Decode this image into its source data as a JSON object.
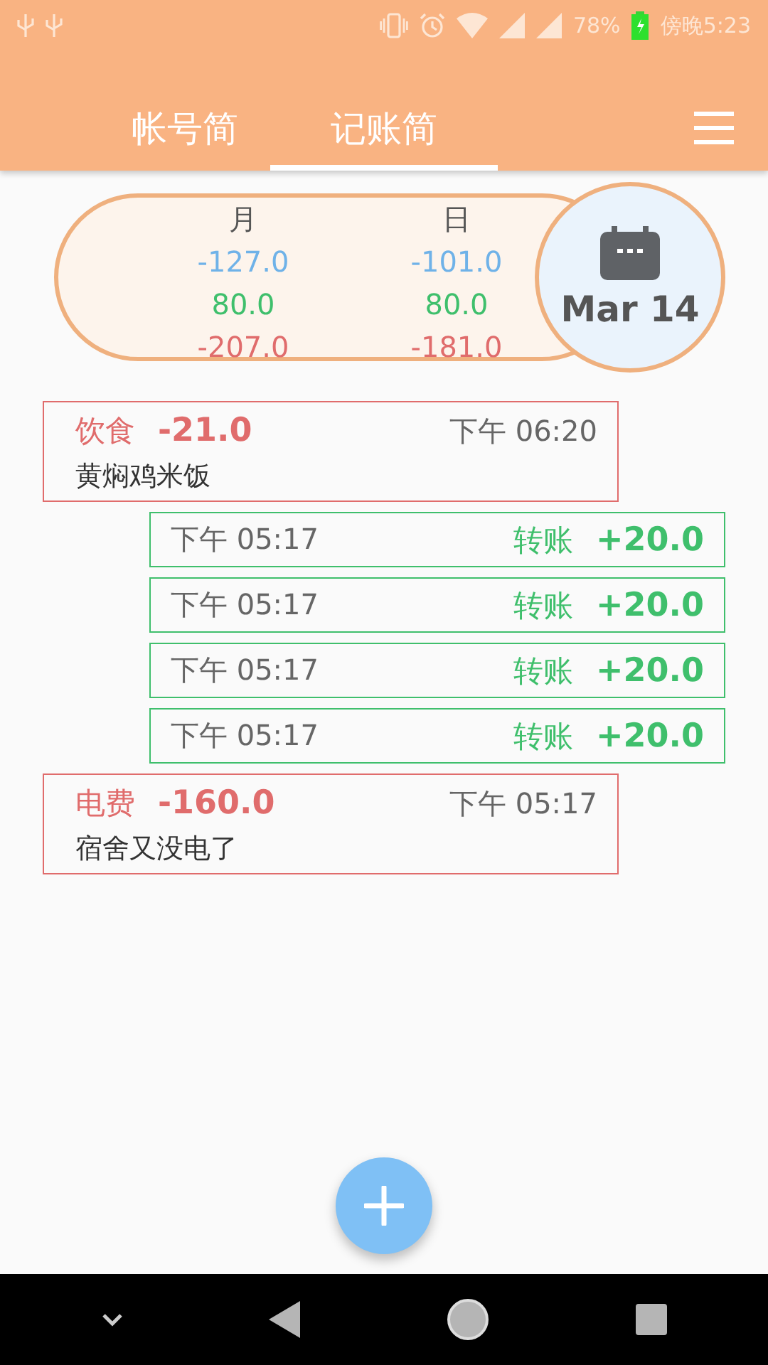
{
  "status_bar": {
    "battery": "78%",
    "time": "傍晚5:23"
  },
  "tabs": [
    {
      "label": "帐号简",
      "selected": false
    },
    {
      "label": "记账简",
      "selected": true
    }
  ],
  "summary": {
    "columns": [
      {
        "label": "月",
        "values": [
          {
            "kind": "balance",
            "text": "-127.0"
          },
          {
            "kind": "income",
            "text": "80.0"
          },
          {
            "kind": "expense",
            "text": "-207.0"
          }
        ]
      },
      {
        "label": "日",
        "values": [
          {
            "kind": "balance",
            "text": "-101.0"
          },
          {
            "kind": "income",
            "text": "80.0"
          },
          {
            "kind": "expense",
            "text": "-181.0"
          }
        ]
      }
    ],
    "date": "Mar 14"
  },
  "entries": [
    {
      "kind": "expense",
      "category": "饮食",
      "amount": "-21.0",
      "time": "下午 06:20",
      "note": "黄焖鸡米饭"
    },
    {
      "kind": "transfer",
      "category": "转账",
      "amount": "+20.0",
      "time": "下午 05:17"
    },
    {
      "kind": "transfer",
      "category": "转账",
      "amount": "+20.0",
      "time": "下午 05:17"
    },
    {
      "kind": "transfer",
      "category": "转账",
      "amount": "+20.0",
      "time": "下午 05:17"
    },
    {
      "kind": "transfer",
      "category": "转账",
      "amount": "+20.0",
      "time": "下午 05:17"
    },
    {
      "kind": "expense",
      "category": "电费",
      "amount": "-160.0",
      "time": "下午 05:17",
      "note": "宿舍又没电了"
    }
  ]
}
